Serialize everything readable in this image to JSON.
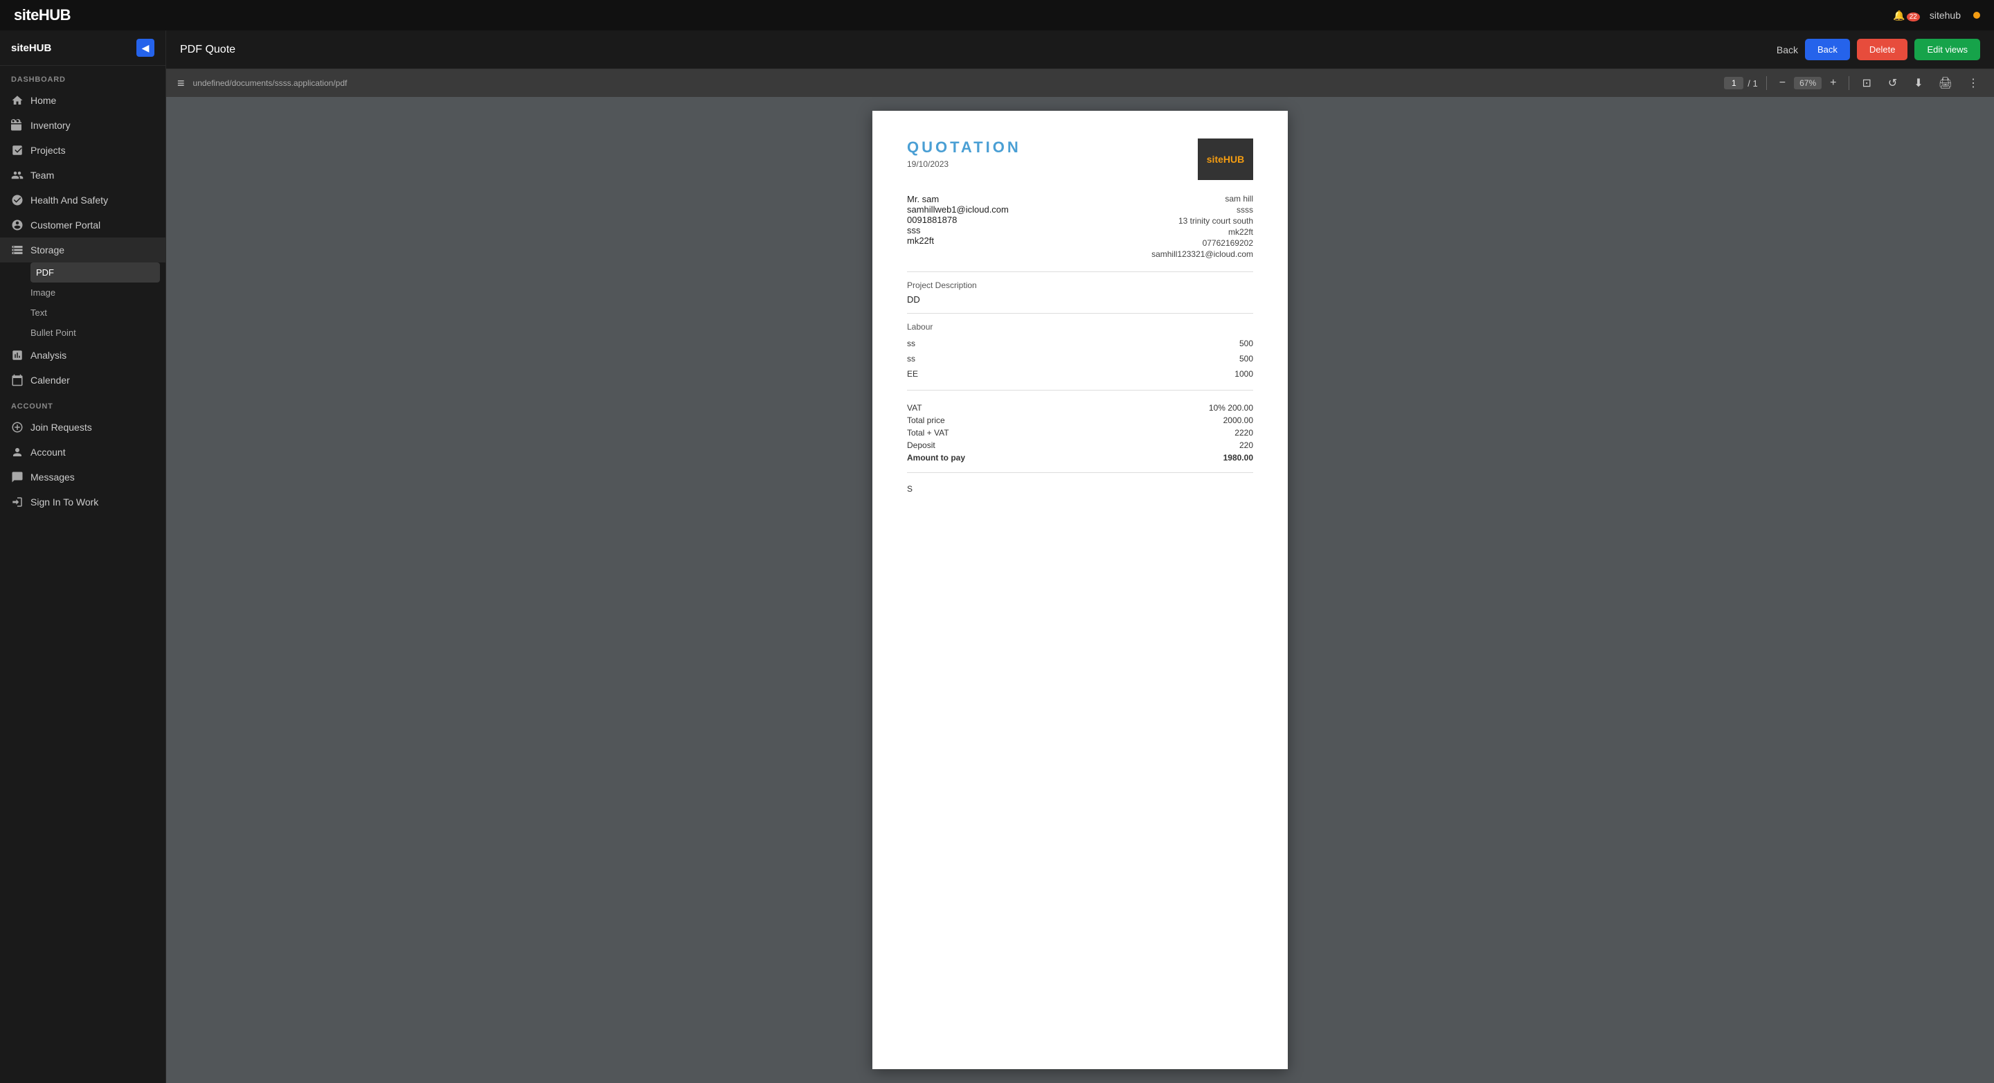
{
  "app": {
    "name": "siteHUB",
    "notification_count": "22",
    "user": "sitehub"
  },
  "topbar": {
    "back_label": "Back"
  },
  "sidebar": {
    "title": "siteHUB",
    "collapse_icon": "◀",
    "dashboard_label": "DASHBOARD",
    "nav_items": [
      {
        "id": "home",
        "label": "Home",
        "icon": "home"
      },
      {
        "id": "inventory",
        "label": "Inventory",
        "icon": "inventory"
      },
      {
        "id": "projects",
        "label": "Projects",
        "icon": "projects"
      },
      {
        "id": "team",
        "label": "Team",
        "icon": "team"
      },
      {
        "id": "health-safety",
        "label": "Health And Safety",
        "icon": "health"
      },
      {
        "id": "customer-portal",
        "label": "Customer Portal",
        "icon": "customer"
      },
      {
        "id": "storage",
        "label": "Storage",
        "icon": "storage",
        "active": true
      }
    ],
    "storage_sub_items": [
      {
        "id": "pdf",
        "label": "PDF",
        "active": true
      },
      {
        "id": "image",
        "label": "Image"
      },
      {
        "id": "text",
        "label": "Text"
      },
      {
        "id": "bullet-point",
        "label": "Bullet Point"
      }
    ],
    "account_label": "ACCOUNT",
    "account_items": [
      {
        "id": "join-requests",
        "label": "Join Requests",
        "icon": "join"
      },
      {
        "id": "account",
        "label": "Account",
        "icon": "account"
      },
      {
        "id": "messages",
        "label": "Messages",
        "icon": "messages"
      },
      {
        "id": "sign-in-to-work",
        "label": "Sign In To Work",
        "icon": "signin"
      }
    ]
  },
  "pdf_header": {
    "title": "PDF Quote",
    "back_label": "Back",
    "delete_label": "Delete",
    "edit_label": "Edit views"
  },
  "pdf_toolbar": {
    "url": "undefined/documents/ssss.application/pdf",
    "current_page": "1",
    "total_pages": "1",
    "zoom": "67%",
    "menu_icon": "≡"
  },
  "pdf_document": {
    "title": "QUOTATION",
    "date": "19/10/2023",
    "client": {
      "name": "Mr. sam",
      "email": "samhillweb1@icloud.com",
      "phone": "0091881878",
      "address1": "sss",
      "address2": "mk22ft"
    },
    "company": {
      "name": "sam hill",
      "company_name": "ssss",
      "address1": "13 trinity court south",
      "address2": "mk22ft",
      "phone": "07762169202",
      "email": "samhill123321@icloud.com",
      "logo_text": "site",
      "logo_accent": "HUB"
    },
    "project_description_label": "Project Description",
    "project_description": "DD",
    "labour_label": "Labour",
    "labour_items": [
      {
        "name": "ss",
        "amount": "500"
      },
      {
        "name": "ss",
        "amount": "500"
      },
      {
        "name": "EE",
        "amount": "1000"
      }
    ],
    "vat_label": "VAT",
    "vat_rate": "10%",
    "vat_amount": "200.00",
    "total_price_label": "Total price",
    "total_price": "2000.00",
    "total_vat_label": "Total + VAT",
    "total_vat": "2220",
    "deposit_label": "Deposit",
    "deposit": "220",
    "amount_to_pay_label": "Amount to pay",
    "amount_to_pay": "1980.00",
    "footer_note": "S"
  }
}
